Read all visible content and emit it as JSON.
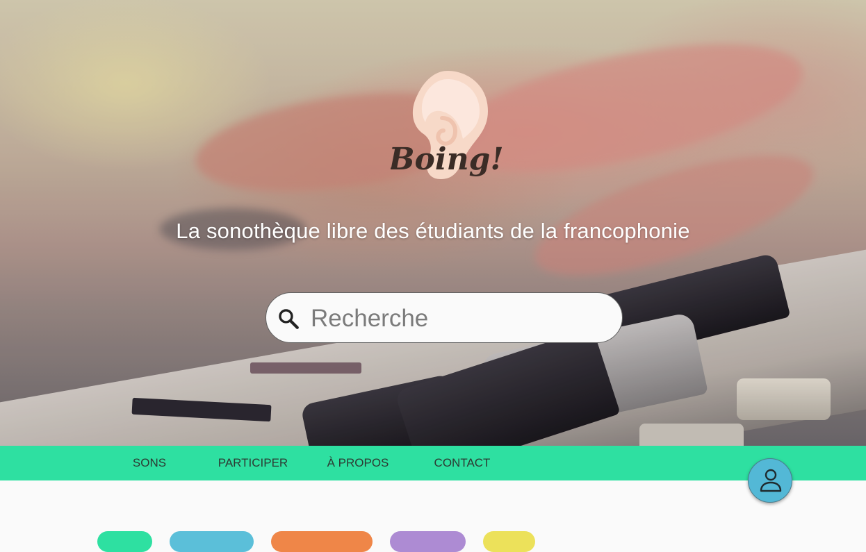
{
  "brand": {
    "name": "Boing!"
  },
  "hero": {
    "tagline": "La sonothèque libre des étudiants de la francophonie"
  },
  "search": {
    "placeholder": "Recherche",
    "icon": "search-icon"
  },
  "nav": {
    "items": [
      {
        "label": "SONS"
      },
      {
        "label": "PARTICIPER"
      },
      {
        "label": "À PROPOS"
      },
      {
        "label": "CONTACT"
      }
    ]
  },
  "profile": {
    "icon": "user-icon",
    "color": "#53b8d6"
  },
  "categories": {
    "colors": [
      "#2ee0a1",
      "#5bbfd9",
      "#ef8648",
      "#ad8bd3",
      "#ece15a"
    ]
  },
  "colors": {
    "nav": "#2ee0a1",
    "accent": "#53b8d6"
  }
}
